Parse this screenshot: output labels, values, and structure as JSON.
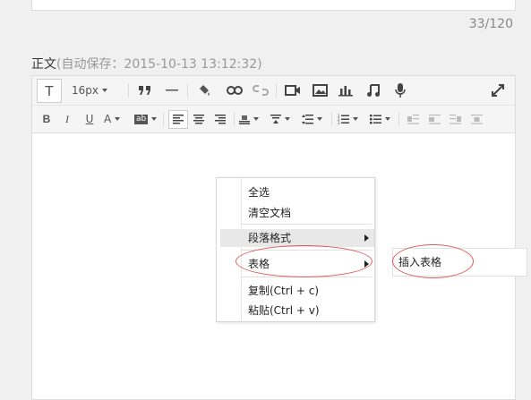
{
  "counter": "33/120",
  "content_label": {
    "title": "正文",
    "autosave": "(自动保存：2015-10-13 13:12:32)"
  },
  "toolbar1": {
    "paragraph_icon": "T",
    "font_size": "16px",
    "quote_icon": "quote-icon",
    "hr_icon": "horizontal-rule-icon",
    "paint_icon": "format-painter-icon",
    "link_icon": "link-icon",
    "unlink_icon": "unlink-icon",
    "video_icon": "video-icon",
    "image_icon": "image-icon",
    "chart_icon": "chart-icon",
    "music_icon": "music-icon",
    "mic_icon": "microphone-icon",
    "fullscreen_icon": "fullscreen-icon"
  },
  "toolbar2": {
    "bold": "B",
    "italic": "I",
    "underline": "U",
    "font_color": "A",
    "bg_color": "ab"
  },
  "context_menu": {
    "items": [
      {
        "label": "全选"
      },
      {
        "label": "清空文档"
      },
      {
        "label": "段落格式"
      },
      {
        "label": "表格"
      },
      {
        "label": "复制(Ctrl + c)"
      },
      {
        "label": "粘贴(Ctrl + v)"
      }
    ]
  },
  "submenu": {
    "items": [
      {
        "label": "插入表格"
      }
    ]
  },
  "colors": {
    "annotation": "#e05a5a",
    "menu_hover": "#e8e8e8",
    "toolbar_bg": "#f5f5f5"
  }
}
